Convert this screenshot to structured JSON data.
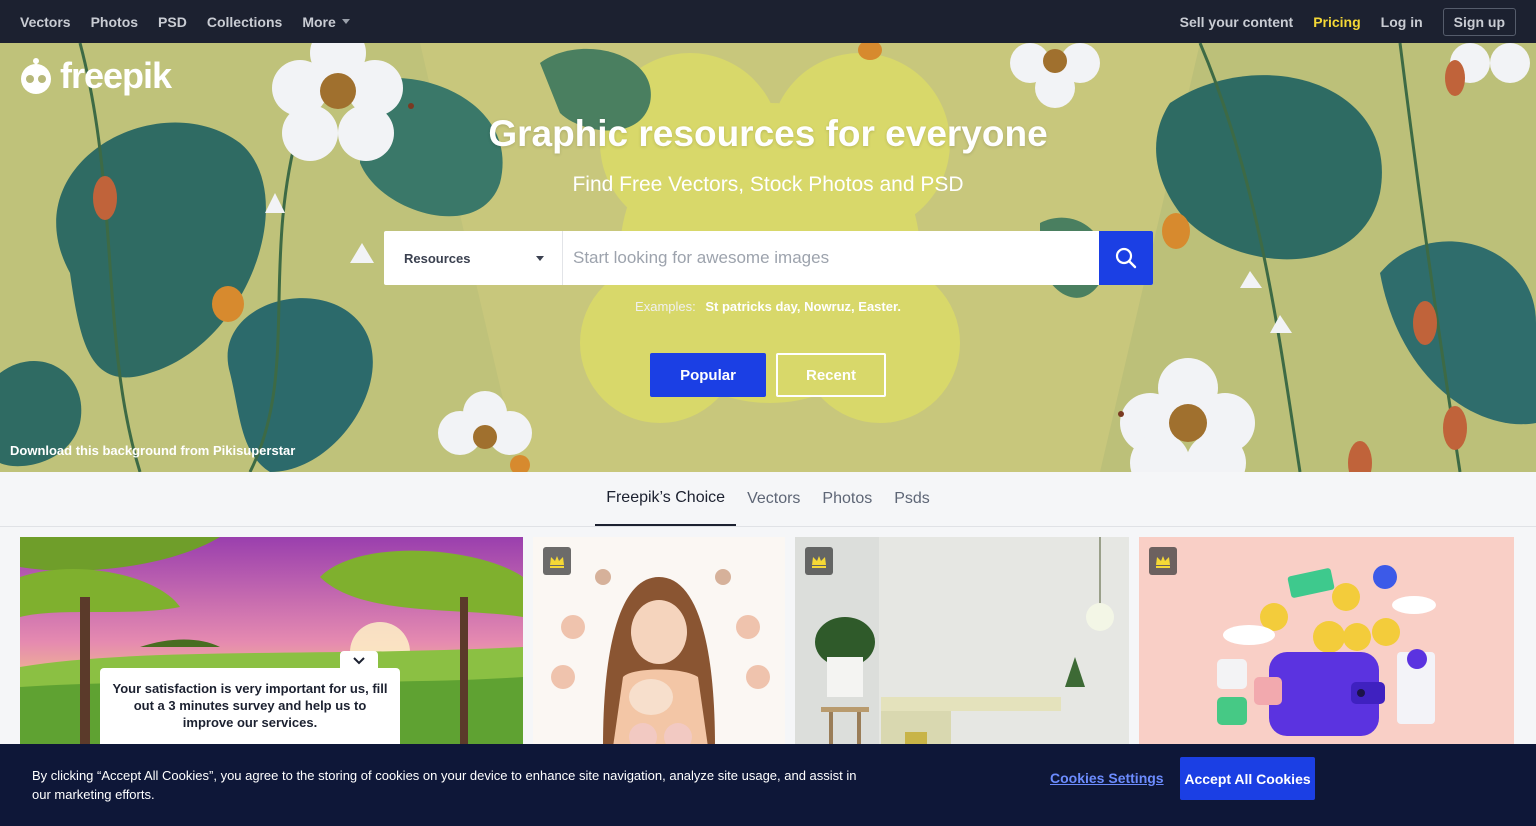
{
  "nav": {
    "left": [
      "Vectors",
      "Photos",
      "PSD",
      "Collections"
    ],
    "more": "More",
    "sell": "Sell your content",
    "pricing": "Pricing",
    "login": "Log in",
    "signup": "Sign up"
  },
  "logo": {
    "text": "freepik"
  },
  "hero": {
    "title": "Graphic resources for everyone",
    "subtitle": "Find Free Vectors, Stock Photos and PSD",
    "search": {
      "type_label": "Resources",
      "placeholder": "Start looking for awesome images"
    },
    "examples": {
      "label": "Examples:",
      "items": "St patricks day, Nowruz, Easter."
    },
    "popular": "Popular",
    "recent": "Recent",
    "credit": "Download this background from Pikisuperstar"
  },
  "tabs": [
    "Freepik’s Choice",
    "Vectors",
    "Photos",
    "Psds"
  ],
  "survey": {
    "text": "Your satisfaction is very important for us, fill out a 3 minutes survey and help us to improve our services."
  },
  "cookie": {
    "text": "By clicking “Accept All Cookies”, you agree to the storing of cookies on your device to enhance site navigation, analyze site usage, and assist in our marketing efforts.",
    "settings": "Cookies Settings",
    "accept": "Accept All Cookies"
  },
  "colors": {
    "nav_bg": "#1c2130",
    "accent_blue": "#1b3fe4",
    "pricing_yellow": "#f5d836",
    "cookie_bg": "#0e1738"
  }
}
